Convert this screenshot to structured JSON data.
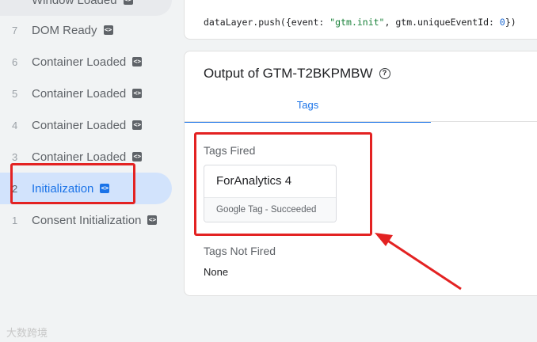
{
  "sidebar": {
    "truncated_event": {
      "label": "Window Loaded"
    },
    "events": [
      {
        "num": "7",
        "label": "DOM Ready"
      },
      {
        "num": "6",
        "label": "Container Loaded"
      },
      {
        "num": "5",
        "label": "Container Loaded"
      },
      {
        "num": "4",
        "label": "Container Loaded"
      },
      {
        "num": "3",
        "label": "Container Loaded"
      },
      {
        "num": "2",
        "label": "Initialization",
        "selected": true
      },
      {
        "num": "1",
        "label": "Consent Initialization"
      }
    ],
    "code_icon": "code-icon"
  },
  "code_panel": {
    "prefix": "dataLayer.push({event: ",
    "event_string": "\"gtm.init\"",
    "middle": ", gtm.uniqueEventId: ",
    "event_id": "0",
    "suffix": "})"
  },
  "output": {
    "title": "Output of GTM-T2BKPMBW",
    "help_icon": "help-icon",
    "tab_label": "Tags",
    "tags_fired_title": "Tags Fired",
    "fired_tag": {
      "name": "ForAnalytics 4",
      "status": "Google Tag - Succeeded"
    },
    "tags_not_fired_title": "Tags Not Fired",
    "not_fired_value": "None"
  },
  "annotation_color": "#e32222",
  "watermark": "大数跨境"
}
